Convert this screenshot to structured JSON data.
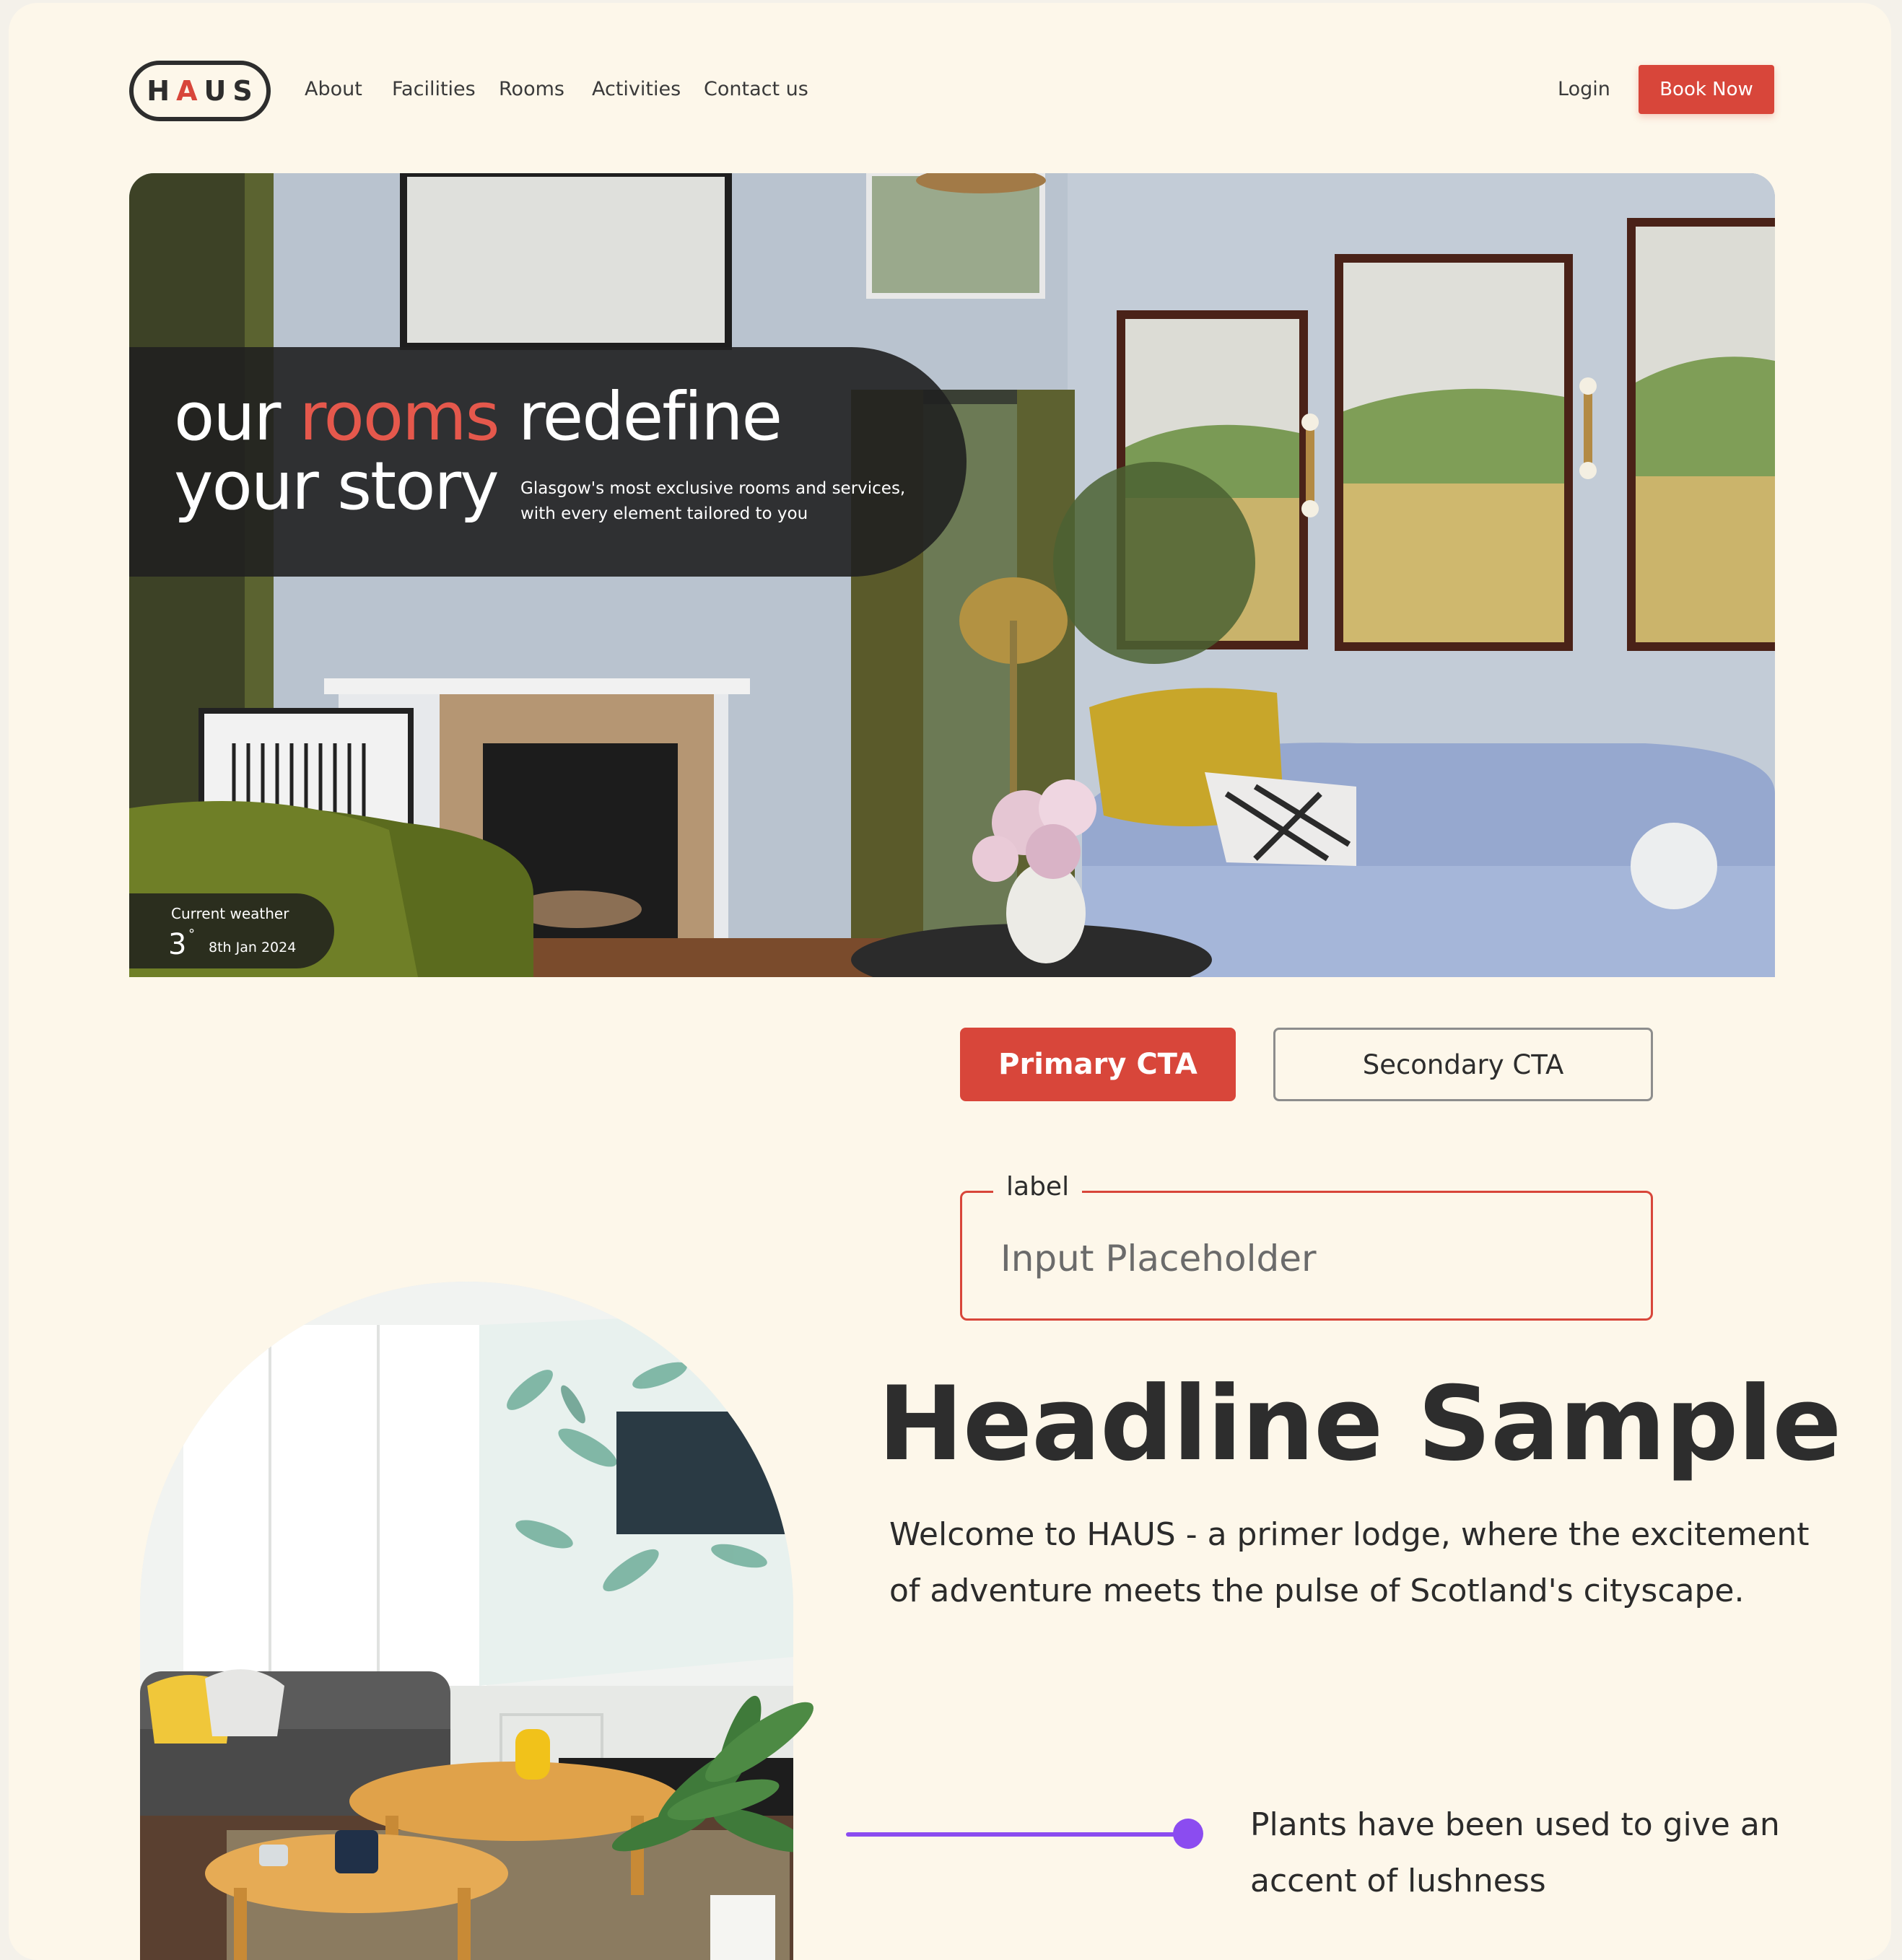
{
  "nav": {
    "logo_prefix": "H",
    "logo_accent": "A",
    "logo_suffix": "US",
    "items": [
      {
        "label": "About"
      },
      {
        "label": "Facilities"
      },
      {
        "label": "Rooms"
      },
      {
        "label": "Activities"
      },
      {
        "label": "Contact us"
      }
    ],
    "login_label": "Login",
    "book_label": "Book Now"
  },
  "hero": {
    "title_part1": "our ",
    "title_highlight": "rooms",
    "title_part2": " redefine",
    "title_line2": "your story",
    "subtitle_line1": "Glasgow's most exclusive rooms and services,",
    "subtitle_line2": "with every element tailored to you",
    "weather": {
      "label": "Current weather",
      "temperature": "3",
      "degree": "°",
      "date": "8th Jan 2024"
    }
  },
  "cta": {
    "primary_label": "Primary CTA",
    "secondary_label": "Secondary CTA"
  },
  "form": {
    "label": "label",
    "placeholder": "Input Placeholder"
  },
  "content": {
    "headline": "Headline Sample",
    "body": "Welcome to HAUS - a primer lodge, where the excitement of adventure meets the pulse of Scotland's cityscape.",
    "annotation": "Plants have been used to give an accent of lushness"
  },
  "colors": {
    "accent": "#d8463a",
    "background": "#fdf7ea",
    "annotation": "#8b4cf0",
    "text": "#2d2d2d"
  },
  "icons": {
    "annotation_marker": "dot-connector"
  }
}
